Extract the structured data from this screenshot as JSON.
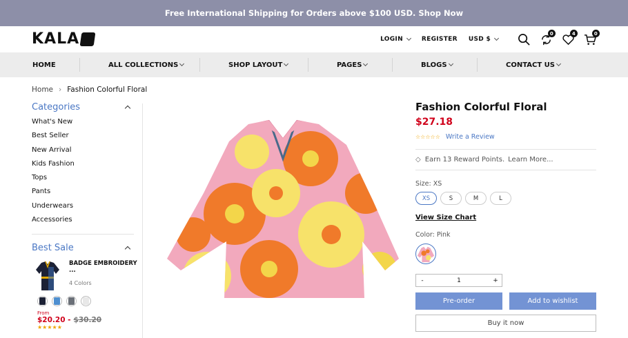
{
  "topbar": {
    "text": "Free International Shipping for Orders above $100 USD. Shop Now"
  },
  "header": {
    "logo": "KALA",
    "login": "LOGIN",
    "register": "REGISTER",
    "currency": "USD $",
    "compare_count": "0",
    "wishlist_count": "4",
    "cart_count": "0"
  },
  "nav": {
    "items": [
      {
        "label": "HOME",
        "dropdown": false
      },
      {
        "label": "ALL COLLECTIONS",
        "dropdown": true
      },
      {
        "label": "SHOP LAYOUT",
        "dropdown": true
      },
      {
        "label": "PAGES",
        "dropdown": true
      },
      {
        "label": "BLOGS",
        "dropdown": true
      },
      {
        "label": "CONTACT US",
        "dropdown": true
      }
    ]
  },
  "breadcrumb": {
    "home": "Home",
    "current": "Fashion Colorful Floral"
  },
  "sidebar": {
    "categories_title": "Categories",
    "categories": [
      "What's New",
      "Best Seller",
      "New Arrival",
      "Kids Fashion",
      "Tops",
      "Pants",
      "Underwears",
      "Accessories"
    ],
    "best_sale_title": "Best Sale",
    "best_sale_item": {
      "name": "BADGE EMBROIDERY ...",
      "colors": "4 Colors",
      "from": "From",
      "price": "$20.20 -",
      "old_price": "$30.20",
      "stars": "★★★★★",
      "swatch_colors": [
        "#1c2135",
        "#4e8fd0",
        "#6b7078",
        "#e8e8e8"
      ]
    }
  },
  "product": {
    "title": "Fashion Colorful Floral",
    "price": "$27.18",
    "stars": "☆☆☆☆☆",
    "write_review": "Write a Review",
    "reward": "Earn 13 Reward Points.",
    "learn_more": "Learn More...",
    "size_label": "Size: XS",
    "sizes": [
      "XS",
      "S",
      "M",
      "L"
    ],
    "selected_size": "XS",
    "size_chart": "View Size Chart",
    "color_label": "Color: Pink",
    "qty_minus": "-",
    "qty_value": "1",
    "qty_plus": "+",
    "preorder": "Pre-order",
    "wishlist": "Add to wishlist",
    "buy_now": "Buy it now"
  },
  "colors": {
    "accent": "#4a77c4",
    "price_red": "#d0021b",
    "topbar_bg": "#8d8fa8",
    "nav_bg": "#ececec",
    "button_bg": "#7393d4"
  }
}
